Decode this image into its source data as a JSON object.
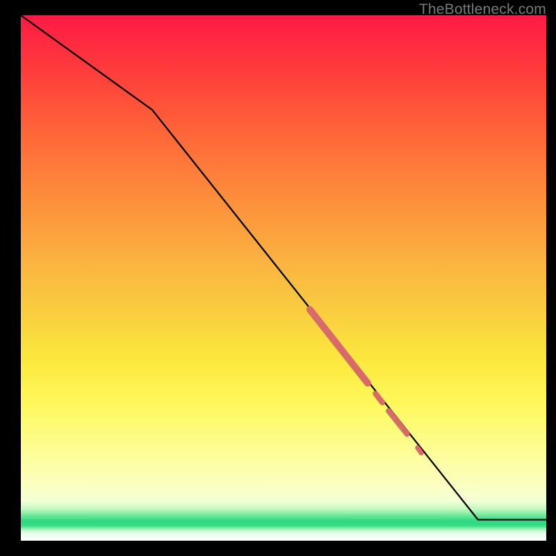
{
  "watermark": "TheBottleneck.com",
  "colors": {
    "line": "#000000",
    "marker": "#d86a6a",
    "bg_black": "#000000"
  },
  "chart_data": {
    "type": "line",
    "title": "",
    "xlabel": "",
    "ylabel": "",
    "xlim": [
      0,
      100
    ],
    "ylim": [
      0,
      100
    ],
    "x": [
      0,
      25,
      87,
      100
    ],
    "values": [
      100,
      82,
      4,
      4
    ],
    "highlight_segments": [
      {
        "x0": 55,
        "y0": 44.0,
        "x1": 66,
        "y1": 30.0,
        "width": 10
      },
      {
        "x0": 67.5,
        "y0": 28.0,
        "x1": 68.8,
        "y1": 26.3,
        "width": 8
      },
      {
        "x0": 70.0,
        "y0": 24.7,
        "x1": 73.5,
        "y1": 20.3,
        "width": 8
      },
      {
        "x0": 75.5,
        "y0": 17.7,
        "x1": 76.2,
        "y1": 16.7,
        "width": 7
      }
    ],
    "notes": "Black curve is the main data line. Salmon rounded segments are highlighted overlays along the descending portion of the line."
  }
}
